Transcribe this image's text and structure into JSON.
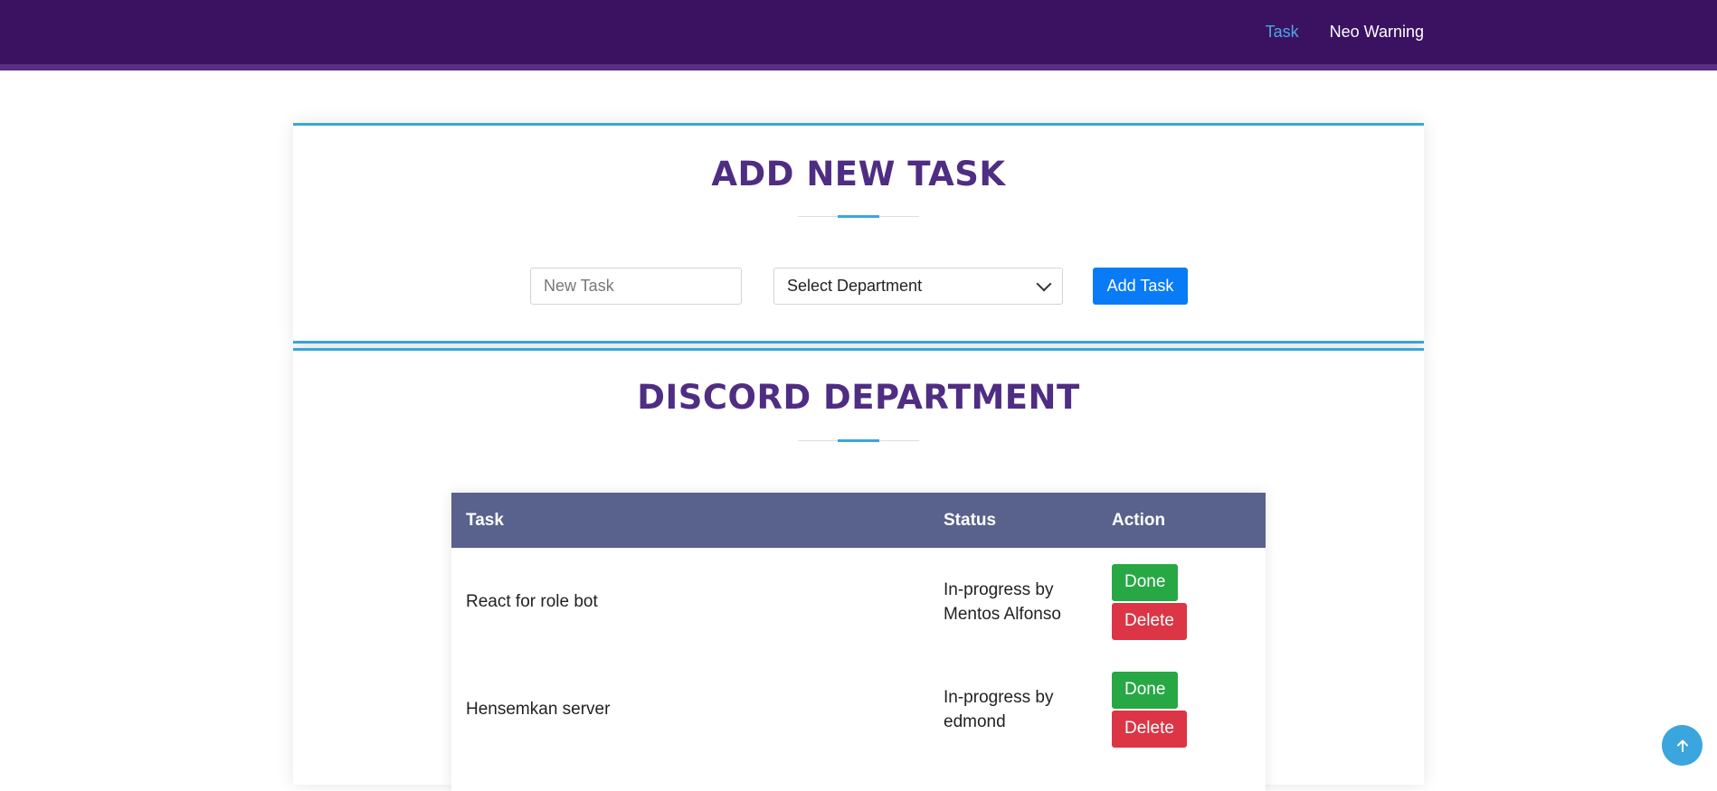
{
  "nav": {
    "items": [
      {
        "label": "Task",
        "active": true
      },
      {
        "label": "Neo Warning",
        "active": false
      }
    ]
  },
  "add_task": {
    "title": "ADD NEW TASK",
    "task_placeholder": "New Task",
    "department_select": "Select Department",
    "add_button": "Add Task"
  },
  "department": {
    "title": "DISCORD DEPARTMENT",
    "columns": [
      "Task",
      "Status",
      "Action"
    ],
    "rows": [
      {
        "task": "React for role bot",
        "status_line1": "In-progress by",
        "status_line2": "Mentos Alfonso",
        "done": "Done",
        "delete": "Delete"
      },
      {
        "task": "Hensemkan server",
        "status_line1": "In-progress by",
        "status_line2": "edmond",
        "done": "Done",
        "delete": "Delete"
      }
    ]
  },
  "colors": {
    "topbar": "#3b1262",
    "accent": "#3aa6dd",
    "title": "#4f2d83",
    "table_header": "#58628c",
    "primary_button": "#0a7bf7",
    "done_button": "#27a844",
    "delete_button": "#dc3545"
  },
  "icons": {
    "scroll_top": "arrow-up-icon",
    "select": "chevron-down-icon"
  }
}
